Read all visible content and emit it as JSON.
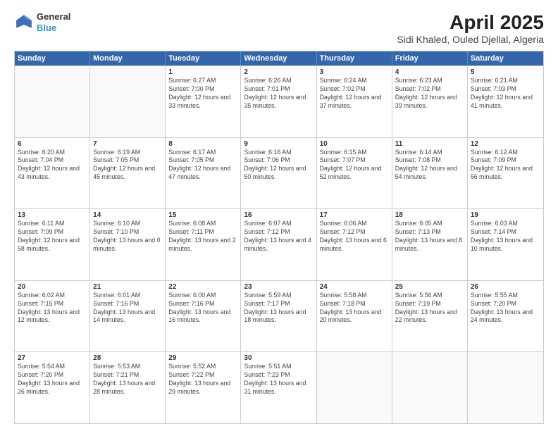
{
  "logo": {
    "line1": "General",
    "line2": "Blue"
  },
  "title": "April 2025",
  "subtitle": "Sidi Khaled, Ouled Djellal, Algeria",
  "header_days": [
    "Sunday",
    "Monday",
    "Tuesday",
    "Wednesday",
    "Thursday",
    "Friday",
    "Saturday"
  ],
  "weeks": [
    [
      {
        "day": "",
        "info": ""
      },
      {
        "day": "",
        "info": ""
      },
      {
        "day": "1",
        "info": "Sunrise: 6:27 AM\nSunset: 7:00 PM\nDaylight: 12 hours\nand 33 minutes."
      },
      {
        "day": "2",
        "info": "Sunrise: 6:26 AM\nSunset: 7:01 PM\nDaylight: 12 hours\nand 35 minutes."
      },
      {
        "day": "3",
        "info": "Sunrise: 6:24 AM\nSunset: 7:02 PM\nDaylight: 12 hours\nand 37 minutes."
      },
      {
        "day": "4",
        "info": "Sunrise: 6:23 AM\nSunset: 7:02 PM\nDaylight: 12 hours\nand 39 minutes."
      },
      {
        "day": "5",
        "info": "Sunrise: 6:21 AM\nSunset: 7:03 PM\nDaylight: 12 hours\nand 41 minutes."
      }
    ],
    [
      {
        "day": "6",
        "info": "Sunrise: 6:20 AM\nSunset: 7:04 PM\nDaylight: 12 hours\nand 43 minutes."
      },
      {
        "day": "7",
        "info": "Sunrise: 6:19 AM\nSunset: 7:05 PM\nDaylight: 12 hours\nand 45 minutes."
      },
      {
        "day": "8",
        "info": "Sunrise: 6:17 AM\nSunset: 7:05 PM\nDaylight: 12 hours\nand 47 minutes."
      },
      {
        "day": "9",
        "info": "Sunrise: 6:16 AM\nSunset: 7:06 PM\nDaylight: 12 hours\nand 50 minutes."
      },
      {
        "day": "10",
        "info": "Sunrise: 6:15 AM\nSunset: 7:07 PM\nDaylight: 12 hours\nand 52 minutes."
      },
      {
        "day": "11",
        "info": "Sunrise: 6:14 AM\nSunset: 7:08 PM\nDaylight: 12 hours\nand 54 minutes."
      },
      {
        "day": "12",
        "info": "Sunrise: 6:12 AM\nSunset: 7:09 PM\nDaylight: 12 hours\nand 56 minutes."
      }
    ],
    [
      {
        "day": "13",
        "info": "Sunrise: 6:11 AM\nSunset: 7:09 PM\nDaylight: 12 hours\nand 58 minutes."
      },
      {
        "day": "14",
        "info": "Sunrise: 6:10 AM\nSunset: 7:10 PM\nDaylight: 13 hours\nand 0 minutes."
      },
      {
        "day": "15",
        "info": "Sunrise: 6:08 AM\nSunset: 7:11 PM\nDaylight: 13 hours\nand 2 minutes."
      },
      {
        "day": "16",
        "info": "Sunrise: 6:07 AM\nSunset: 7:12 PM\nDaylight: 13 hours\nand 4 minutes."
      },
      {
        "day": "17",
        "info": "Sunrise: 6:06 AM\nSunset: 7:12 PM\nDaylight: 13 hours\nand 6 minutes."
      },
      {
        "day": "18",
        "info": "Sunrise: 6:05 AM\nSunset: 7:13 PM\nDaylight: 13 hours\nand 8 minutes."
      },
      {
        "day": "19",
        "info": "Sunrise: 6:03 AM\nSunset: 7:14 PM\nDaylight: 13 hours\nand 10 minutes."
      }
    ],
    [
      {
        "day": "20",
        "info": "Sunrise: 6:02 AM\nSunset: 7:15 PM\nDaylight: 13 hours\nand 12 minutes."
      },
      {
        "day": "21",
        "info": "Sunrise: 6:01 AM\nSunset: 7:16 PM\nDaylight: 13 hours\nand 14 minutes."
      },
      {
        "day": "22",
        "info": "Sunrise: 6:00 AM\nSunset: 7:16 PM\nDaylight: 13 hours\nand 16 minutes."
      },
      {
        "day": "23",
        "info": "Sunrise: 5:59 AM\nSunset: 7:17 PM\nDaylight: 13 hours\nand 18 minutes."
      },
      {
        "day": "24",
        "info": "Sunrise: 5:58 AM\nSunset: 7:18 PM\nDaylight: 13 hours\nand 20 minutes."
      },
      {
        "day": "25",
        "info": "Sunrise: 5:56 AM\nSunset: 7:19 PM\nDaylight: 13 hours\nand 22 minutes."
      },
      {
        "day": "26",
        "info": "Sunrise: 5:55 AM\nSunset: 7:20 PM\nDaylight: 13 hours\nand 24 minutes."
      }
    ],
    [
      {
        "day": "27",
        "info": "Sunrise: 5:54 AM\nSunset: 7:20 PM\nDaylight: 13 hours\nand 26 minutes."
      },
      {
        "day": "28",
        "info": "Sunrise: 5:53 AM\nSunset: 7:21 PM\nDaylight: 13 hours\nand 28 minutes."
      },
      {
        "day": "29",
        "info": "Sunrise: 5:52 AM\nSunset: 7:22 PM\nDaylight: 13 hours\nand 29 minutes."
      },
      {
        "day": "30",
        "info": "Sunrise: 5:51 AM\nSunset: 7:23 PM\nDaylight: 13 hours\nand 31 minutes."
      },
      {
        "day": "",
        "info": ""
      },
      {
        "day": "",
        "info": ""
      },
      {
        "day": "",
        "info": ""
      }
    ]
  ]
}
